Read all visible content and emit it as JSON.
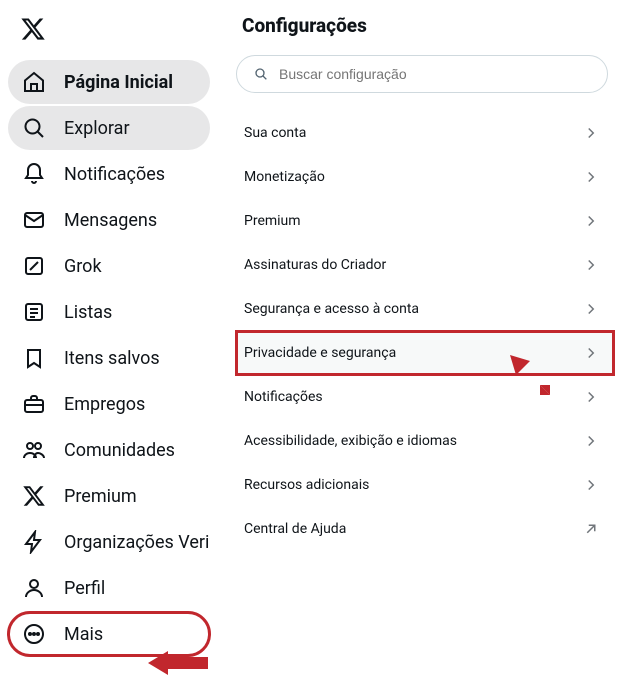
{
  "sidebar": {
    "items": [
      {
        "label": "Página Inicial",
        "icon": "home-icon"
      },
      {
        "label": "Explorar",
        "icon": "search-icon"
      },
      {
        "label": "Notificações",
        "icon": "bell-icon"
      },
      {
        "label": "Mensagens",
        "icon": "mail-icon"
      },
      {
        "label": "Grok",
        "icon": "grok-icon"
      },
      {
        "label": "Listas",
        "icon": "list-icon"
      },
      {
        "label": "Itens salvos",
        "icon": "bookmark-icon"
      },
      {
        "label": "Empregos",
        "icon": "briefcase-icon"
      },
      {
        "label": "Comunidades",
        "icon": "communities-icon"
      },
      {
        "label": "Premium",
        "icon": "x-icon"
      },
      {
        "label": "Organizações Verif",
        "icon": "bolt-icon"
      },
      {
        "label": "Perfil",
        "icon": "profile-icon"
      },
      {
        "label": "Mais",
        "icon": "more-icon"
      }
    ]
  },
  "header": {
    "title": "Configurações"
  },
  "search": {
    "placeholder": "Buscar configuração"
  },
  "settings": {
    "items": [
      {
        "label": "Sua conta",
        "kind": "chevron"
      },
      {
        "label": "Monetização",
        "kind": "chevron"
      },
      {
        "label": "Premium",
        "kind": "chevron"
      },
      {
        "label": "Assinaturas do Criador",
        "kind": "chevron"
      },
      {
        "label": "Segurança e acesso à conta",
        "kind": "chevron"
      },
      {
        "label": "Privacidade e segurança",
        "kind": "chevron",
        "selected": true,
        "highlighted": true
      },
      {
        "label": "Notificações",
        "kind": "chevron"
      },
      {
        "label": "Acessibilidade, exibição e idiomas",
        "kind": "chevron"
      },
      {
        "label": "Recursos adicionais",
        "kind": "chevron"
      },
      {
        "label": "Central de Ajuda",
        "kind": "external"
      }
    ]
  },
  "annotations": {
    "highlight_color": "#c1272d"
  }
}
